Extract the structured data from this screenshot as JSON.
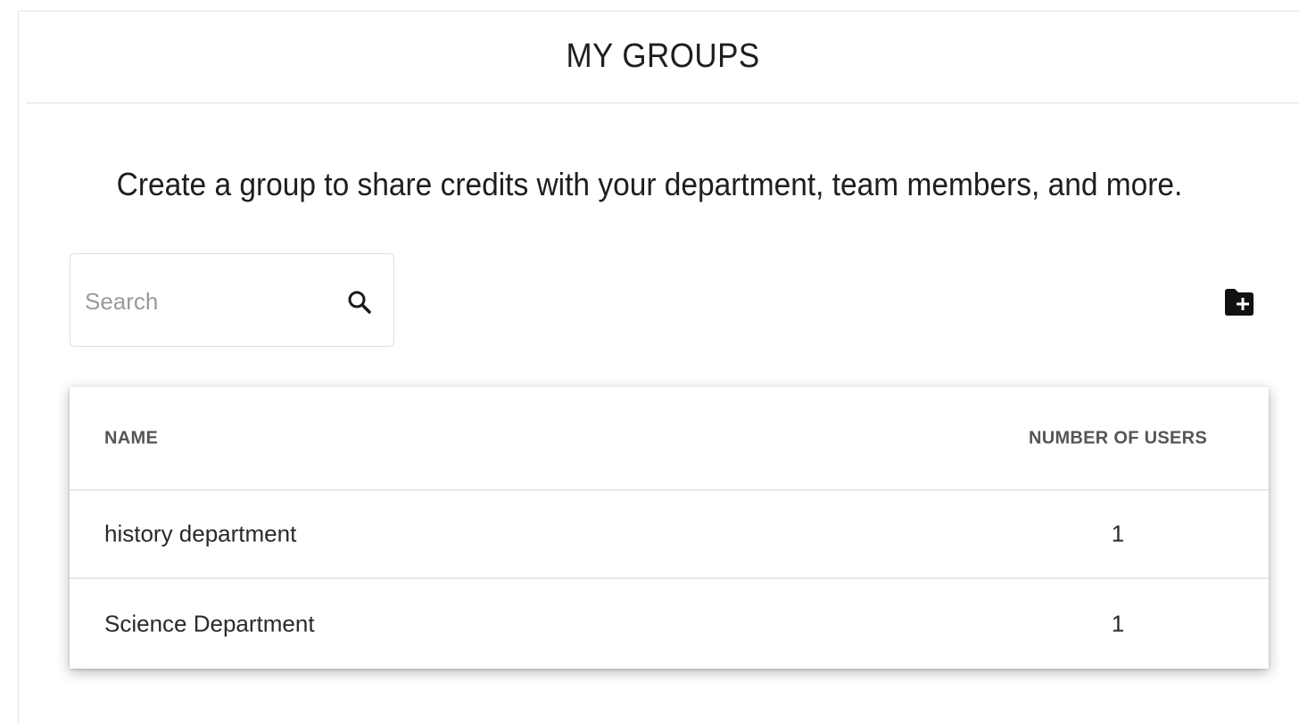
{
  "header": {
    "title": "MY GROUPS"
  },
  "subtitle": "Create a group to share credits with your department, team members, and more.",
  "search": {
    "placeholder": "Search",
    "value": ""
  },
  "toolbar": {
    "add_group_icon": "folder-plus-icon"
  },
  "table": {
    "columns": [
      "NAME",
      "NUMBER OF USERS"
    ],
    "rows": [
      {
        "name": "history department",
        "users": "1"
      },
      {
        "name": "Science Department",
        "users": "1"
      }
    ]
  }
}
